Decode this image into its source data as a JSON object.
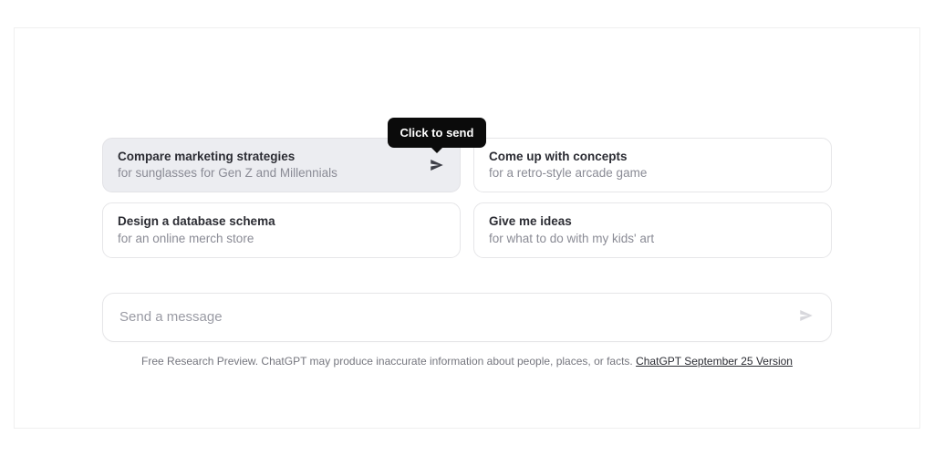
{
  "tooltip": {
    "text": "Click to send"
  },
  "suggestions": [
    {
      "title": "Compare marketing strategies",
      "subtitle": "for sunglasses for Gen Z and Millennials"
    },
    {
      "title": "Come up with concepts",
      "subtitle": "for a retro-style arcade game"
    },
    {
      "title": "Design a database schema",
      "subtitle": "for an online merch store"
    },
    {
      "title": "Give me ideas",
      "subtitle": "for what to do with my kids' art"
    }
  ],
  "input": {
    "placeholder": "Send a message"
  },
  "footer": {
    "text": "Free Research Preview. ChatGPT may produce inaccurate information about people, places, or facts. ",
    "link_label": "ChatGPT September 25 Version"
  }
}
